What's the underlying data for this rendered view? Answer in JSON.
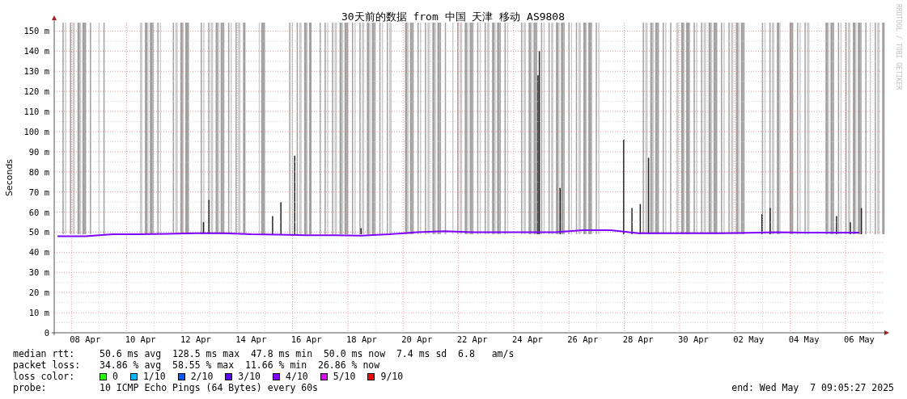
{
  "graph": {
    "title": "30天前的数据 from 中国 天津 移动 AS9808",
    "credit": "RRDTOOL / TOBI OETIKER",
    "chart_data": {
      "type": "line",
      "ylabel": "Seconds",
      "ylim": [
        0,
        155
      ],
      "grid": true,
      "categories": [
        null,
        "08 Apr",
        null,
        "10 Apr",
        null,
        "12 Apr",
        null,
        "14 Apr",
        null,
        "16 Apr",
        null,
        "18 Apr",
        null,
        "20 Apr",
        null,
        "22 Apr",
        null,
        "24 Apr",
        null,
        "26 Apr",
        null,
        "28 Apr",
        null,
        "30 Apr",
        null,
        "02 May",
        null,
        "04 May",
        null,
        "06 May"
      ],
      "yticks": [
        {
          "value": 0,
          "label": "0"
        },
        {
          "value": 10,
          "label": "10 m"
        },
        {
          "value": 20,
          "label": "20 m"
        },
        {
          "value": 30,
          "label": "30 m"
        },
        {
          "value": 40,
          "label": "40 m"
        },
        {
          "value": 50,
          "label": "50 m"
        },
        {
          "value": 60,
          "label": "60 m"
        },
        {
          "value": 70,
          "label": "70 m"
        },
        {
          "value": 80,
          "label": "80 m"
        },
        {
          "value": 90,
          "label": "90 m"
        },
        {
          "value": 100,
          "label": "100 m"
        },
        {
          "value": 110,
          "label": "110 m"
        },
        {
          "value": 120,
          "label": "120 m"
        },
        {
          "value": 130,
          "label": "130 m"
        },
        {
          "value": 140,
          "label": "140 m"
        },
        {
          "value": 150,
          "label": "150 m"
        }
      ],
      "series": [
        {
          "color": "#7e00ff",
          "values": [
            48,
            48,
            49,
            49,
            49.2,
            49.5,
            49.5,
            49,
            48.8,
            48.5,
            48.5,
            48.3,
            49,
            50,
            50.5,
            50,
            50,
            50,
            50,
            51,
            51,
            49.5,
            49.5,
            49.5,
            49.5,
            49.7,
            50,
            49.8,
            49.8,
            49.8
          ]
        }
      ]
    }
  },
  "stats": [
    {
      "label": "median rtt:",
      "value": "50.6 ms avg  128.5 ms max  47.8 ms min  50.0 ms now  7.4 ms sd  6.8   am/s"
    },
    {
      "label": "packet loss:",
      "value": "34.86 % avg  58.55 % max  11.66 % min  26.86 % now"
    }
  ],
  "loss_color": {
    "label": "loss color:",
    "items": [
      {
        "text": "0",
        "color": "#26ff00"
      },
      {
        "text": "1/10",
        "color": "#00b8ff"
      },
      {
        "text": "2/10",
        "color": "#0059ff"
      },
      {
        "text": "3/10",
        "color": "#5e00ff"
      },
      {
        "text": "4/10",
        "color": "#7e00ff"
      },
      {
        "text": "5/10",
        "color": "#dd00ff"
      },
      {
        "text": "9/10",
        "color": "#ff0000"
      }
    ]
  },
  "probe": {
    "label": "probe:",
    "value": "10 ICMP Echo Pings (64 Bytes) every 60s"
  },
  "end": "end: Wed May  7 09:05:27 2025"
}
